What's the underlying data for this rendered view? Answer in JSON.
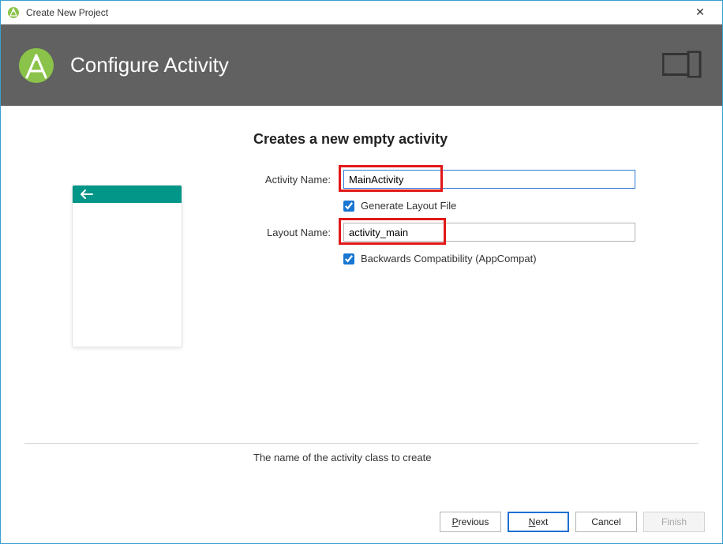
{
  "titlebar": {
    "title": "Create New Project",
    "close_glyph": "✕"
  },
  "header": {
    "title": "Configure Activity"
  },
  "section_title": "Creates a new empty activity",
  "form": {
    "activity_name_label": "Activity Name:",
    "activity_name_value": "MainActivity",
    "generate_layout_label": "Generate Layout File",
    "generate_layout_checked": true,
    "layout_name_label": "Layout Name:",
    "layout_name_value": "activity_main",
    "backwards_compat_label": "Backwards Compatibility (AppCompat)",
    "backwards_compat_checked": true
  },
  "hint_text": "The name of the activity class to create",
  "buttons": {
    "previous": "Previous",
    "next": "Next",
    "cancel": "Cancel",
    "finish": "Finish"
  }
}
